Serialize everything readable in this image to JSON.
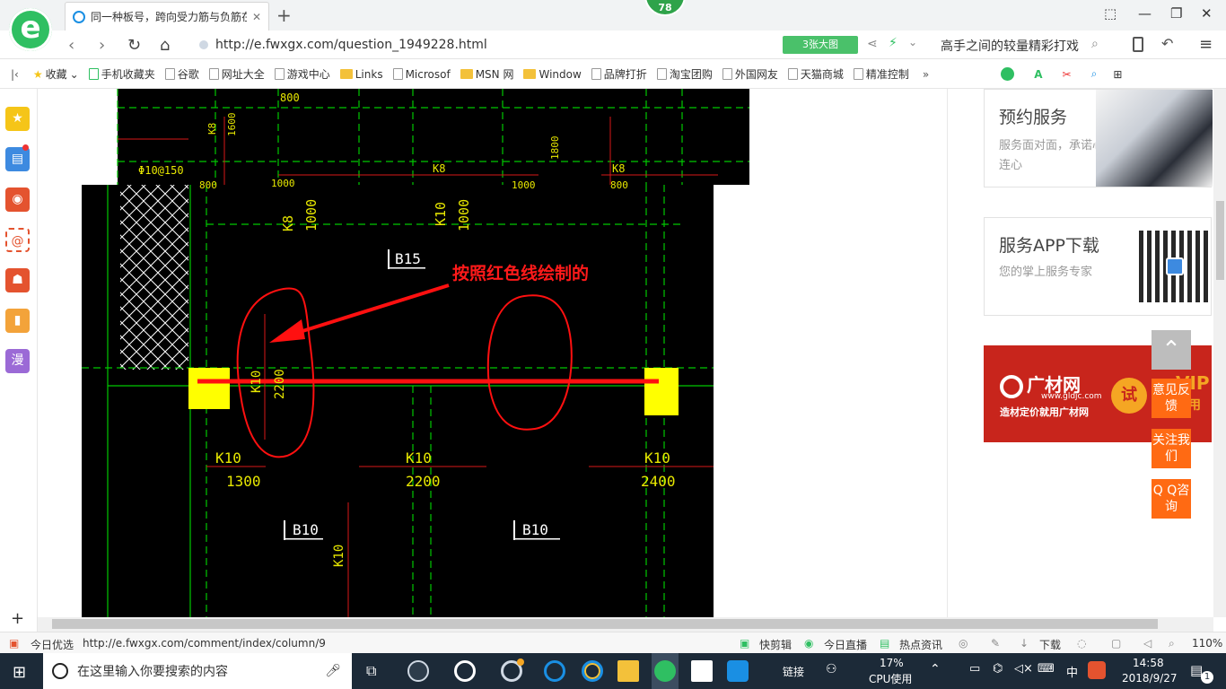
{
  "browser": {
    "tab_title": "同一种板号，跨向受力筋与负筋在...",
    "badge": "78",
    "url": "http://e.fwxgx.com/question_1949228.html",
    "big_image_btn": "3张大图",
    "search_query": "高手之间的较量精彩打戏"
  },
  "bookmarks": [
    {
      "label": "收藏",
      "type": "star"
    },
    {
      "label": "手机收藏夹",
      "type": "phone"
    },
    {
      "label": "谷歌",
      "type": "page"
    },
    {
      "label": "网址大全",
      "type": "page"
    },
    {
      "label": "游戏中心",
      "type": "page"
    },
    {
      "label": "Links",
      "type": "folder"
    },
    {
      "label": "Microsof",
      "type": "page"
    },
    {
      "label": "MSN 网",
      "type": "folder"
    },
    {
      "label": "Window",
      "type": "folder"
    },
    {
      "label": "品牌打折",
      "type": "page"
    },
    {
      "label": "淘宝团购",
      "type": "page"
    },
    {
      "label": "外国网友",
      "type": "page"
    },
    {
      "label": "天猫商城",
      "type": "page"
    },
    {
      "label": "精准控制",
      "type": "page"
    }
  ],
  "sidebar": {
    "manga_label": "漫"
  },
  "cad": {
    "annotation": "按照红色线绘制的",
    "labels": [
      {
        "t": "800"
      },
      {
        "t": "K8"
      },
      {
        "t": "1600"
      },
      {
        "t": "1800"
      },
      {
        "t": "Φ10@150"
      },
      {
        "t": "K8"
      },
      {
        "t": "K8"
      },
      {
        "t": "K8"
      },
      {
        "t": "1000"
      },
      {
        "t": "K10"
      },
      {
        "t": "1000"
      },
      {
        "t": "B15"
      },
      {
        "t": "K10"
      },
      {
        "t": "2200"
      },
      {
        "t": "K10"
      },
      {
        "t": "1300"
      },
      {
        "t": "K10"
      },
      {
        "t": "2200"
      },
      {
        "t": "K10"
      },
      {
        "t": "2400"
      },
      {
        "t": "B10"
      },
      {
        "t": "B10"
      },
      {
        "t": "K10"
      },
      {
        "t": "800"
      },
      {
        "t": "1000"
      },
      {
        "t": "1000"
      },
      {
        "t": "800"
      }
    ]
  },
  "cards": [
    {
      "title": "预约服务",
      "desc": "服务面对面，承诺心连心"
    },
    {
      "title": "服务APP下载",
      "desc": "您的掌上服务专家"
    }
  ],
  "ad": {
    "brand": "广材网",
    "site": "www.gldjc.com",
    "slogan": "造材定价就用广材网",
    "try": "试",
    "vip": "VIP",
    "trial": "试用"
  },
  "float_buttons": [
    {
      "label": "意见反馈"
    },
    {
      "label": "关注我们"
    },
    {
      "label": "Q Q咨询"
    }
  ],
  "status": {
    "today": "今日优选",
    "hover_url": "http://e.fwxgx.com/comment/index/column/9",
    "items": [
      "快剪辑",
      "今日直播",
      "热点资讯",
      "下载"
    ],
    "zoom": "110%"
  },
  "taskbar": {
    "search_placeholder": "在这里输入你要搜索的内容",
    "link": "链接",
    "cpu": "17%",
    "cpu_label": "CPU使用",
    "ime": "中",
    "time": "14:58",
    "date": "2018/9/27",
    "notif_count": "1"
  }
}
